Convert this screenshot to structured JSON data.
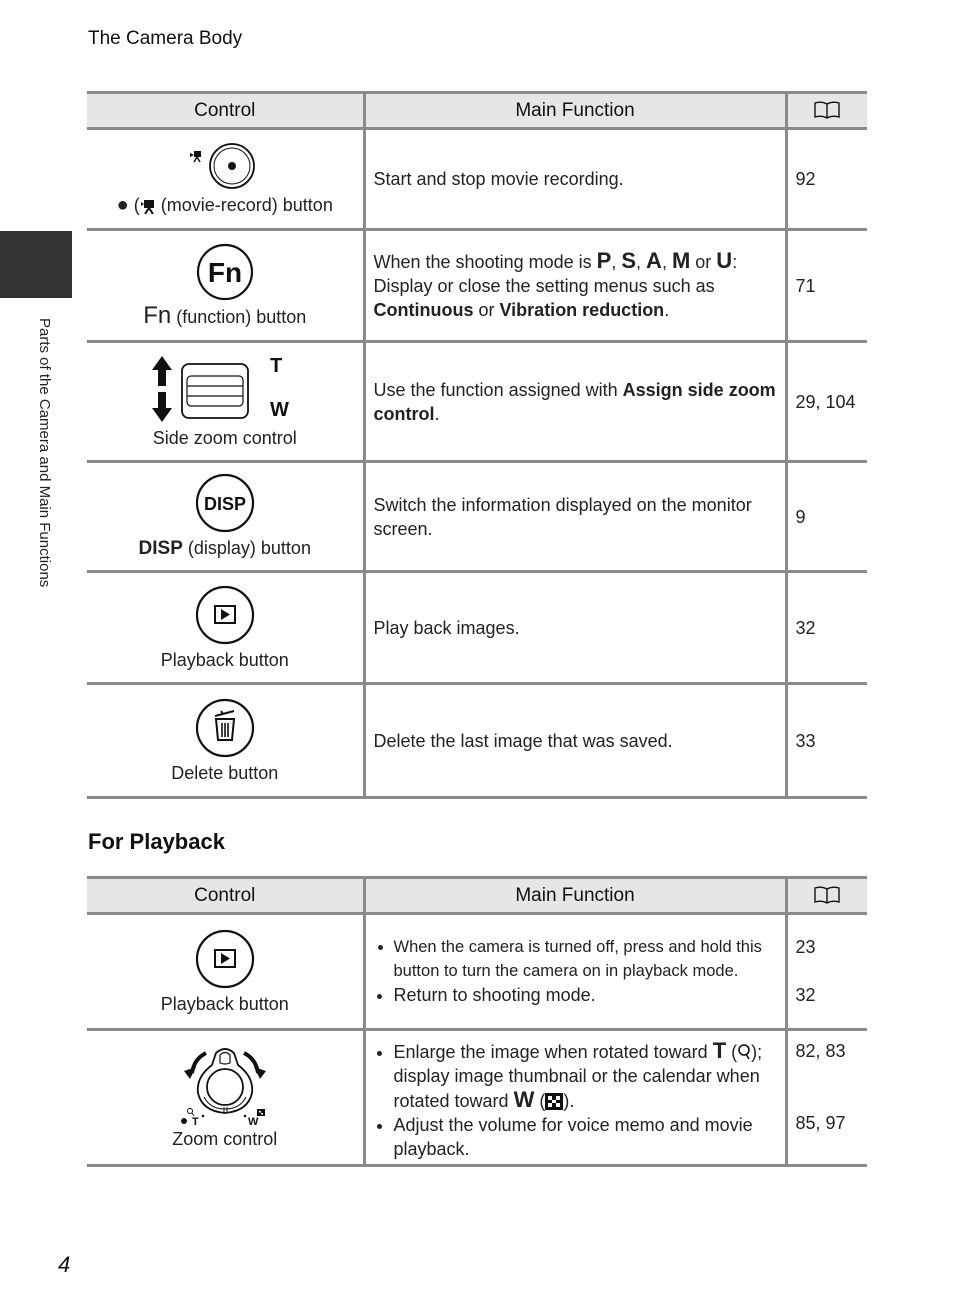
{
  "running_head": "The Camera Body",
  "side_tab": {
    "label": "Parts of the Camera and Main Functions"
  },
  "page_number": "4",
  "table_headers": {
    "control": "Control",
    "main_function": "Main Function",
    "ref_icon": "book-reference-icon"
  },
  "shooting_rows": [
    {
      "icon": "movie-record-button-icon",
      "label_prefix": "●",
      "label": "(movie-record) button",
      "function": "Start and stop movie recording.",
      "ref": "92"
    },
    {
      "icon": "fn-button-icon",
      "label_prefix": "Fn",
      "label": "(function) button",
      "function_parts": {
        "intro": "When the shooting mode is ",
        "modes": [
          "P",
          "S",
          "A",
          "M",
          "U"
        ],
        "sep": ", ",
        "or": " or ",
        "line2": "Display or close the setting menus such as ",
        "b1": "Continuous",
        "mid": " or ",
        "b2": "Vibration reduction",
        "end": "."
      },
      "ref": "71"
    },
    {
      "icon": "side-zoom-control-icon",
      "icon_labels": {
        "tele": "T",
        "wide": "W"
      },
      "label": "Side zoom control",
      "function_parts": {
        "intro": "Use the function assigned with ",
        "b1": "Assign side zoom control",
        "end": "."
      },
      "ref": "29, 104"
    },
    {
      "icon": "disp-button-icon",
      "icon_text": "DISP",
      "label_prefix": "DISP",
      "label": "(display) button",
      "function": "Switch the information displayed on the monitor screen.",
      "ref": "9"
    },
    {
      "icon": "playback-button-icon",
      "label": "Playback button",
      "function": "Play back images.",
      "ref": "32"
    },
    {
      "icon": "delete-button-icon",
      "label": "Delete button",
      "function": "Delete the last image that was saved.",
      "ref": "33"
    }
  ],
  "playback_section": {
    "title": "For Playback",
    "rows": [
      {
        "icon": "playback-button-icon",
        "label": "Playback button",
        "bullets": [
          "When the camera is turned off, press and hold this button to turn the camera on in playback mode.",
          "Return to shooting mode."
        ],
        "refs": [
          "23",
          "32"
        ]
      },
      {
        "icon": "zoom-control-icon",
        "icon_labels": {
          "tele": "T",
          "wide": "W"
        },
        "label": "Zoom control",
        "bullet1_parts": {
          "a": "Enlarge the image when rotated toward ",
          "t": "T",
          "b": " (",
          "c": "); display image thumbnail or the calendar when rotated toward ",
          "w": "W",
          "d": " (",
          "e": ")."
        },
        "bullet2": "Adjust the volume for voice memo and movie playback.",
        "refs": [
          "82, 83",
          "85, 97"
        ]
      }
    ]
  }
}
